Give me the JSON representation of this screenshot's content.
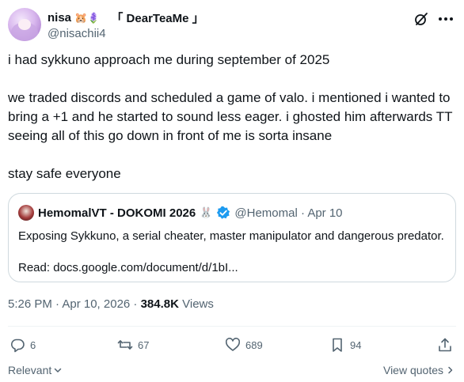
{
  "author": {
    "name": "nisa",
    "emojis": "🐹🪻",
    "tag": "「 DearTeaMe 」",
    "handle": "@nisachii4"
  },
  "tweet": {
    "paragraphs": [
      "i had sykkuno approach me during september of 2025",
      "we traded discords and scheduled a game of valo. i mentioned i wanted to bring a +1 and he started to sound less eager. i ghosted him afterwards TT seeing all of this go down in front of me is sorta insane",
      "stay safe everyone"
    ]
  },
  "quote": {
    "name": "HemomalVT - DOKOMI 2026",
    "name_emoji": "🐰",
    "handle_date": "@Hemomal · Apr 10",
    "line1": "Exposing Sykkuno, a serial cheater, master manipulator and dangerous predator.",
    "line2": "Read: docs.google.com/document/d/1bI..."
  },
  "meta": {
    "time": "5:26 PM · Apr 10, 2026 · ",
    "views_count": "384.8K",
    "views_label": " Views"
  },
  "actions": {
    "replies": "6",
    "reposts": "67",
    "likes": "689",
    "bookmarks": "94"
  },
  "footer": {
    "sort_label": "Relevant",
    "view_quotes": "View quotes"
  },
  "colors": {
    "text": "#0f1419",
    "secondary": "#536471",
    "verified": "#1d9bf0",
    "border": "#cfd9de"
  }
}
